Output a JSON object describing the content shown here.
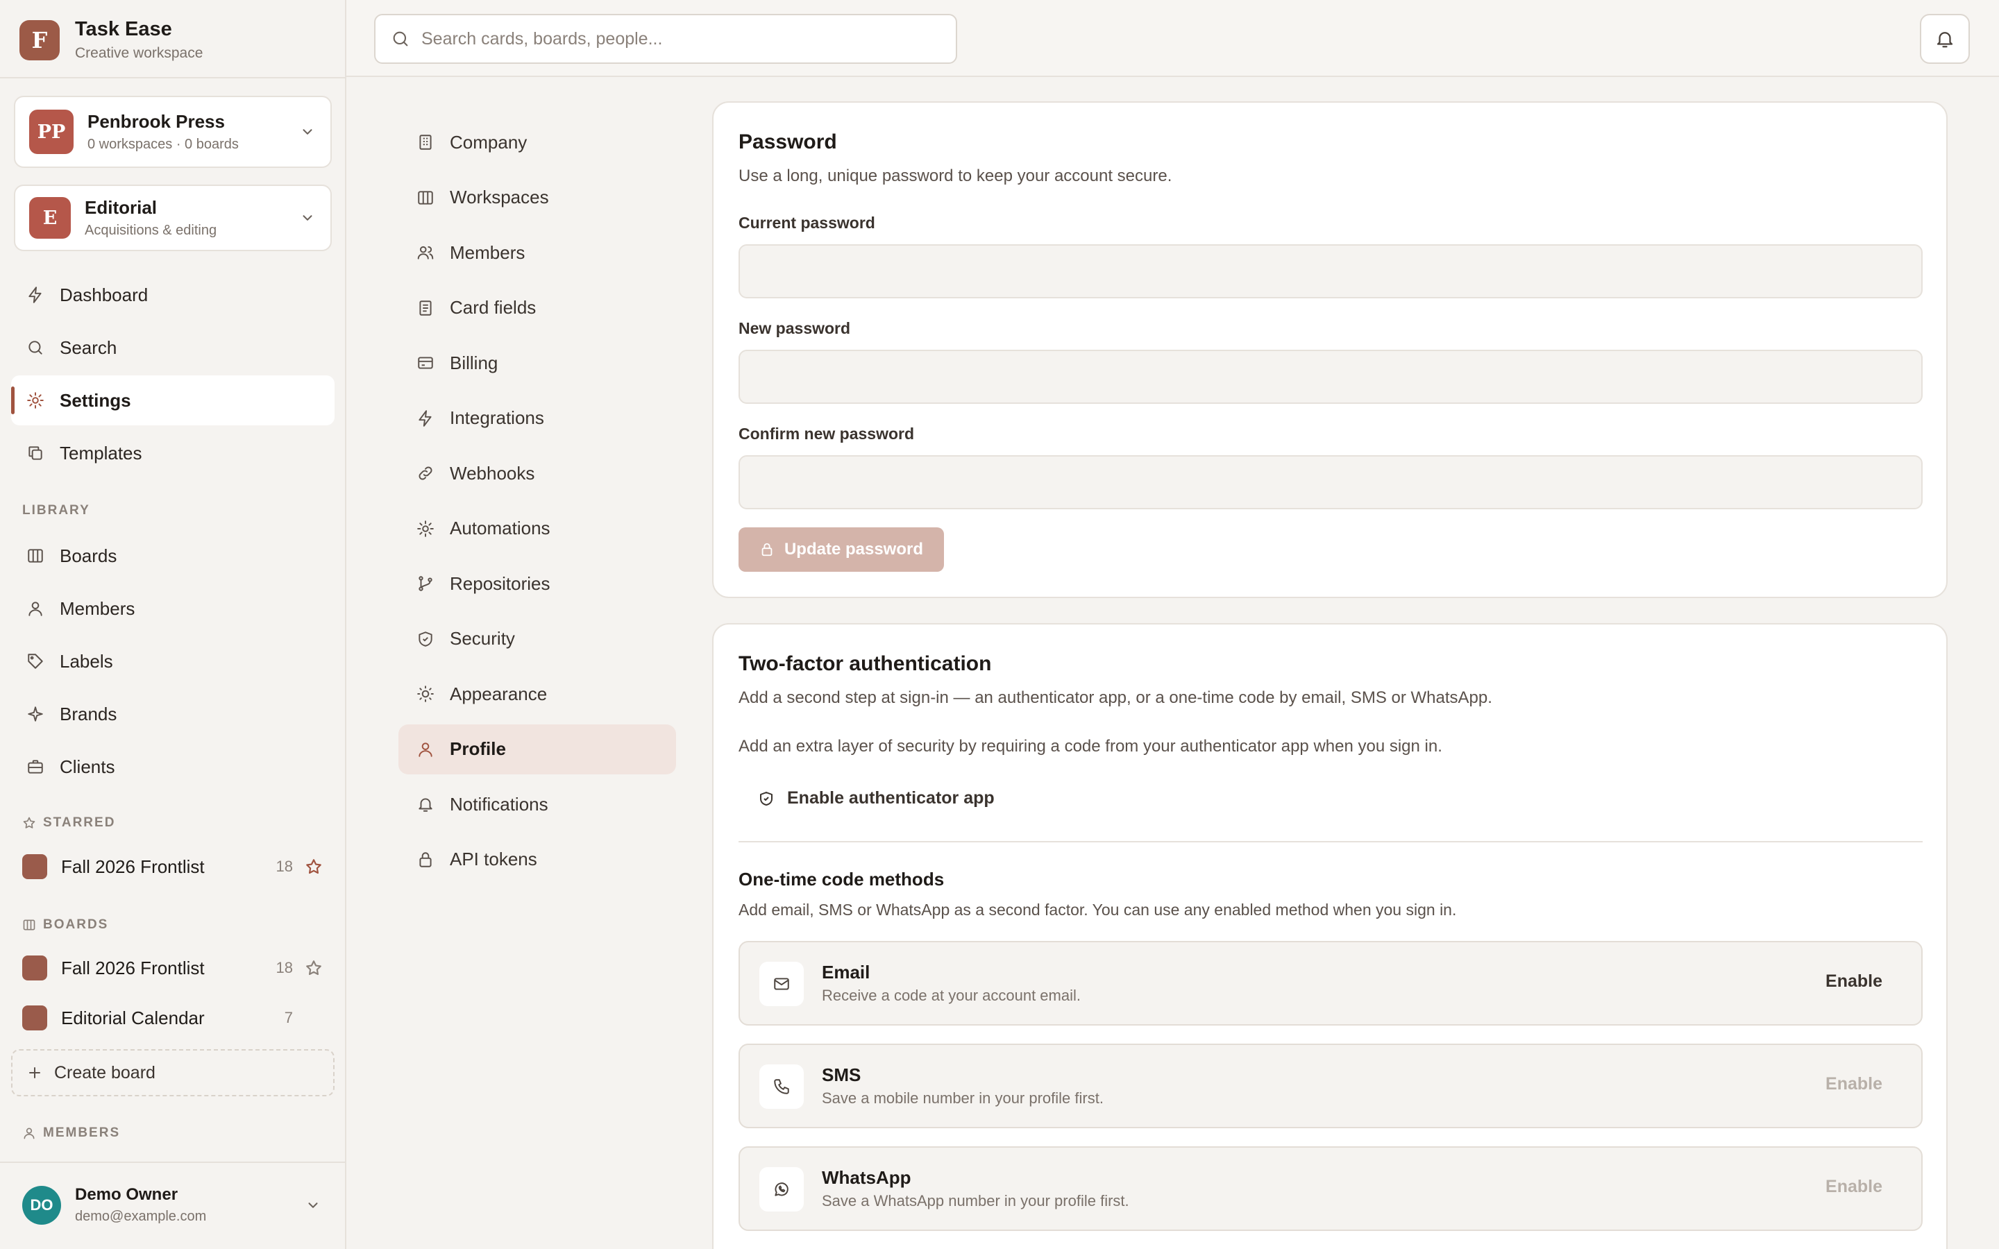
{
  "app": {
    "logo_letter": "F",
    "title": "Task Ease",
    "subtitle": "Creative workspace"
  },
  "workspaces": [
    {
      "initials": "PP",
      "name": "Penbrook Press",
      "meta": "0 workspaces · 0 boards",
      "color": "#b5574a"
    },
    {
      "initials": "E",
      "name": "Editorial",
      "meta": "Acquisitions & editing",
      "color": "#b5574a"
    }
  ],
  "nav": {
    "main": [
      {
        "icon": "bolt-icon",
        "label": "Dashboard"
      },
      {
        "icon": "search-icon",
        "label": "Search"
      },
      {
        "icon": "gear-icon",
        "label": "Settings",
        "active": true
      },
      {
        "icon": "copy-icon",
        "label": "Templates"
      }
    ],
    "library_label": "LIBRARY",
    "library": [
      {
        "icon": "columns-icon",
        "label": "Boards"
      },
      {
        "icon": "user-icon",
        "label": "Members"
      },
      {
        "icon": "tag-icon",
        "label": "Labels"
      },
      {
        "icon": "sparkle-icon",
        "label": "Brands"
      },
      {
        "icon": "briefcase-icon",
        "label": "Clients"
      }
    ]
  },
  "starred": {
    "label": "STARRED",
    "items": [
      {
        "name": "Fall 2026 Frontlist",
        "count": "18",
        "starred": true
      }
    ]
  },
  "boards": {
    "label": "BOARDS",
    "items": [
      {
        "name": "Fall 2026 Frontlist",
        "count": "18"
      },
      {
        "name": "Editorial Calendar",
        "count": "7"
      }
    ],
    "create_label": "Create board"
  },
  "members_label": "MEMBERS",
  "user": {
    "initials": "DO",
    "name": "Demo Owner",
    "email": "demo@example.com"
  },
  "topbar": {
    "search_placeholder": "Search cards, boards, people..."
  },
  "settings_nav": [
    {
      "icon": "building-icon",
      "label": "Company"
    },
    {
      "icon": "columns-icon",
      "label": "Workspaces"
    },
    {
      "icon": "users-icon",
      "label": "Members"
    },
    {
      "icon": "document-icon",
      "label": "Card fields"
    },
    {
      "icon": "credit-card-icon",
      "label": "Billing"
    },
    {
      "icon": "bolt-icon",
      "label": "Integrations"
    },
    {
      "icon": "link-icon",
      "label": "Webhooks"
    },
    {
      "icon": "gear-icon",
      "label": "Automations"
    },
    {
      "icon": "git-branch-icon",
      "label": "Repositories"
    },
    {
      "icon": "shield-icon",
      "label": "Security"
    },
    {
      "icon": "sun-icon",
      "label": "Appearance"
    },
    {
      "icon": "user-icon",
      "label": "Profile",
      "active": true
    },
    {
      "icon": "bell-icon",
      "label": "Notifications"
    },
    {
      "icon": "lock-icon",
      "label": "API tokens"
    }
  ],
  "password": {
    "title": "Password",
    "description": "Use a long, unique password to keep your account secure.",
    "current_label": "Current password",
    "current_value": "",
    "new_label": "New password",
    "new_value": "",
    "confirm_label": "Confirm new password",
    "confirm_value": "",
    "button_label": "Update password"
  },
  "two_factor": {
    "title": "Two-factor authentication",
    "description": "Add a second step at sign-in — an authenticator app, or a one-time code by email, SMS or WhatsApp.",
    "app_description": "Add an extra layer of security by requiring a code from your authenticator app when you sign in.",
    "enable_app_label": "Enable authenticator app",
    "otp_title": "One-time code methods",
    "otp_description": "Add email, SMS or WhatsApp as a second factor. You can use any enabled method when you sign in.",
    "methods": [
      {
        "icon": "mail-icon",
        "name": "Email",
        "description": "Receive a code at your account email.",
        "action": "Enable",
        "enabled": true
      },
      {
        "icon": "phone-icon",
        "name": "SMS",
        "description": "Save a mobile number in your profile first.",
        "action": "Enable",
        "enabled": false
      },
      {
        "icon": "whatsapp-icon",
        "name": "WhatsApp",
        "description": "Save a WhatsApp number in your profile first.",
        "action": "Enable",
        "enabled": false
      }
    ]
  },
  "colors": {
    "accent": "#a0533f",
    "active_bg": "#f1e4df",
    "board_swatch": "#9a5b4b",
    "avatar": "#1f8a8a"
  }
}
